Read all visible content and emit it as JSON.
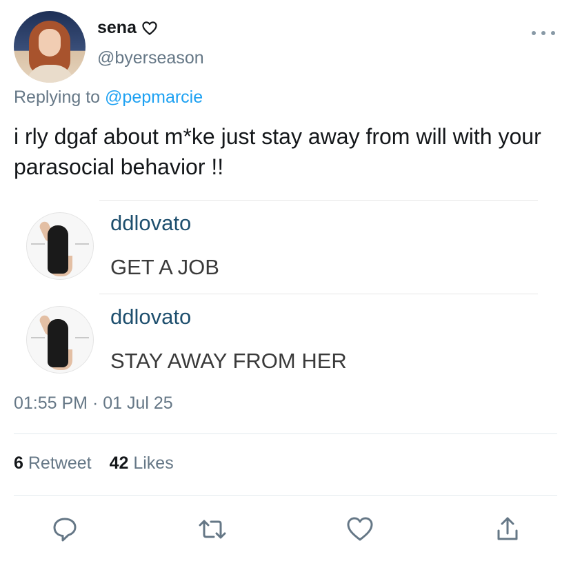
{
  "author": {
    "display_name": "sena",
    "handle": "@byerseason"
  },
  "reply": {
    "prefix": "Replying to ",
    "mention": "@pepmarcie"
  },
  "tweet_text": "i rly dgaf about m*ke just stay away from will with your parasocial behavior !!",
  "embedded_comments": [
    {
      "username": "ddlovato",
      "message": "GET A JOB"
    },
    {
      "username": "ddlovato",
      "message": "STAY AWAY FROM HER"
    }
  ],
  "timestamp": "01:55 PM · 01 Jul 25",
  "stats": {
    "retweet_count": "6",
    "retweet_label": "Retweet",
    "like_count": "42",
    "like_label": "Likes"
  },
  "icons": {
    "more": "more-icon",
    "reply": "reply-icon",
    "retweet": "retweet-icon",
    "like": "heart-icon",
    "share": "share-icon",
    "name_heart": "heart-outline-icon"
  },
  "colors": {
    "text": "#14171a",
    "secondary": "#657786",
    "link": "#1da1f2",
    "icon": "#657786"
  }
}
